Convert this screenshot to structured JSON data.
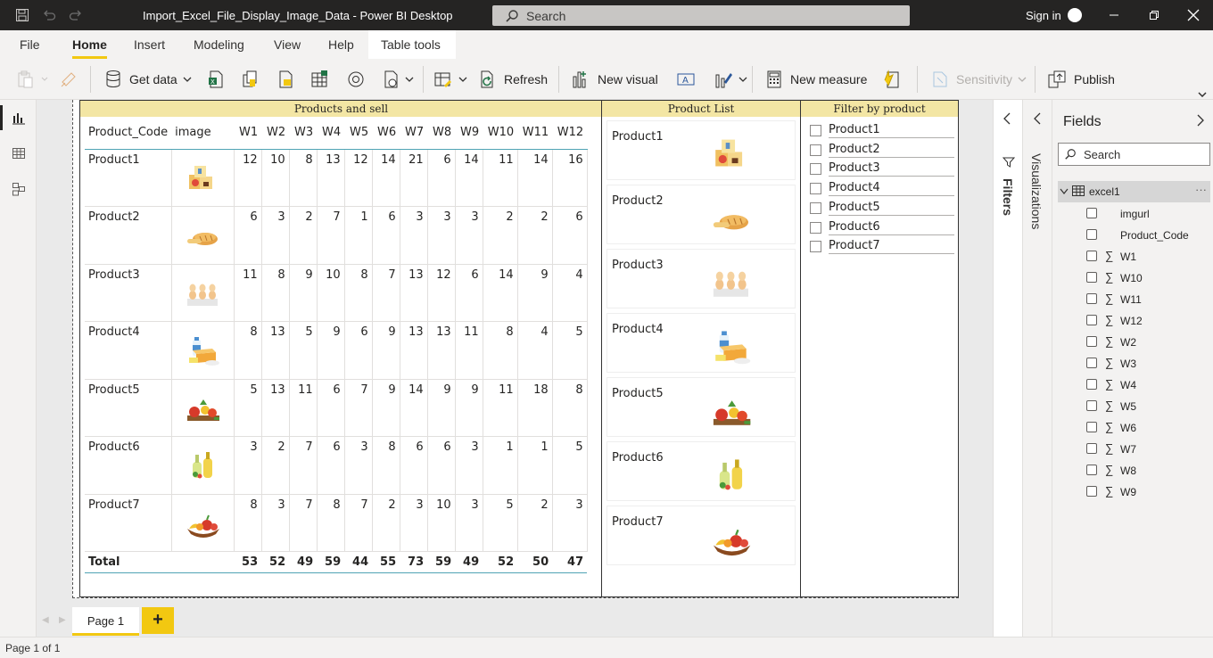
{
  "window": {
    "title": "Import_Excel_File_Display_Image_Data - Power BI Desktop",
    "search_placeholder": "Search",
    "signin": "Sign in"
  },
  "menu": {
    "tabs": [
      "File",
      "Home",
      "Insert",
      "Modeling",
      "View",
      "Help",
      "Table tools"
    ],
    "active": "Home"
  },
  "ribbon": {
    "get_data": "Get data",
    "refresh": "Refresh",
    "new_visual": "New visual",
    "new_measure": "New measure",
    "sensitivity": "Sensitivity",
    "publish": "Publish"
  },
  "table_visual": {
    "title": "Products and sell",
    "columns": [
      "Product_Code",
      "image",
      "W1",
      "W2",
      "W3",
      "W4",
      "W5",
      "W6",
      "W7",
      "W8",
      "W9",
      "W10",
      "W11",
      "W12"
    ],
    "rows": [
      {
        "code": "Product1",
        "icon": "baby-food-icon",
        "values": [
          12,
          10,
          8,
          13,
          12,
          14,
          21,
          6,
          14,
          11,
          14,
          16
        ]
      },
      {
        "code": "Product2",
        "icon": "bread-icon",
        "values": [
          6,
          3,
          2,
          7,
          1,
          6,
          3,
          3,
          3,
          2,
          2,
          6
        ]
      },
      {
        "code": "Product3",
        "icon": "eggs-icon",
        "values": [
          11,
          8,
          9,
          10,
          8,
          7,
          13,
          12,
          6,
          14,
          9,
          4
        ]
      },
      {
        "code": "Product4",
        "icon": "dairy-icon",
        "values": [
          8,
          13,
          5,
          9,
          6,
          9,
          13,
          13,
          11,
          8,
          4,
          5
        ]
      },
      {
        "code": "Product5",
        "icon": "vegetables-icon",
        "values": [
          5,
          13,
          11,
          6,
          7,
          9,
          14,
          9,
          9,
          11,
          18,
          8
        ]
      },
      {
        "code": "Product6",
        "icon": "oil-bottles-icon",
        "values": [
          3,
          2,
          7,
          6,
          3,
          8,
          6,
          6,
          3,
          1,
          1,
          5
        ]
      },
      {
        "code": "Product7",
        "icon": "fruit-basket-icon",
        "values": [
          8,
          3,
          7,
          8,
          7,
          2,
          3,
          10,
          3,
          5,
          2,
          3
        ]
      }
    ],
    "total_label": "Total",
    "totals": [
      53,
      52,
      49,
      59,
      44,
      55,
      73,
      59,
      49,
      52,
      50,
      47
    ]
  },
  "list_visual": {
    "title": "Product List",
    "items": [
      "Product1",
      "Product2",
      "Product3",
      "Product4",
      "Product5",
      "Product6",
      "Product7"
    ]
  },
  "slicer": {
    "title": "Filter by product",
    "items": [
      "Product1",
      "Product2",
      "Product3",
      "Product4",
      "Product5",
      "Product6",
      "Product7"
    ]
  },
  "pages": {
    "tab": "Page 1",
    "add": "+",
    "status": "Page 1 of 1"
  },
  "panes": {
    "filters": "Filters",
    "visualizations": "Visualizations",
    "fields_title": "Fields",
    "fields_search": "Search",
    "table_name": "excel1",
    "more": "···",
    "fields": [
      {
        "name": "imgurl",
        "sigma": false
      },
      {
        "name": "Product_Code",
        "sigma": false
      },
      {
        "name": "W1",
        "sigma": true
      },
      {
        "name": "W10",
        "sigma": true
      },
      {
        "name": "W11",
        "sigma": true
      },
      {
        "name": "W12",
        "sigma": true
      },
      {
        "name": "W2",
        "sigma": true
      },
      {
        "name": "W3",
        "sigma": true
      },
      {
        "name": "W4",
        "sigma": true
      },
      {
        "name": "W5",
        "sigma": true
      },
      {
        "name": "W6",
        "sigma": true
      },
      {
        "name": "W7",
        "sigma": true
      },
      {
        "name": "W8",
        "sigma": true
      },
      {
        "name": "W9",
        "sigma": true
      }
    ]
  },
  "colors": {
    "accent": "#f2c811",
    "title_band": "#f3e6a4",
    "table_rule": "#4fa3b4"
  }
}
